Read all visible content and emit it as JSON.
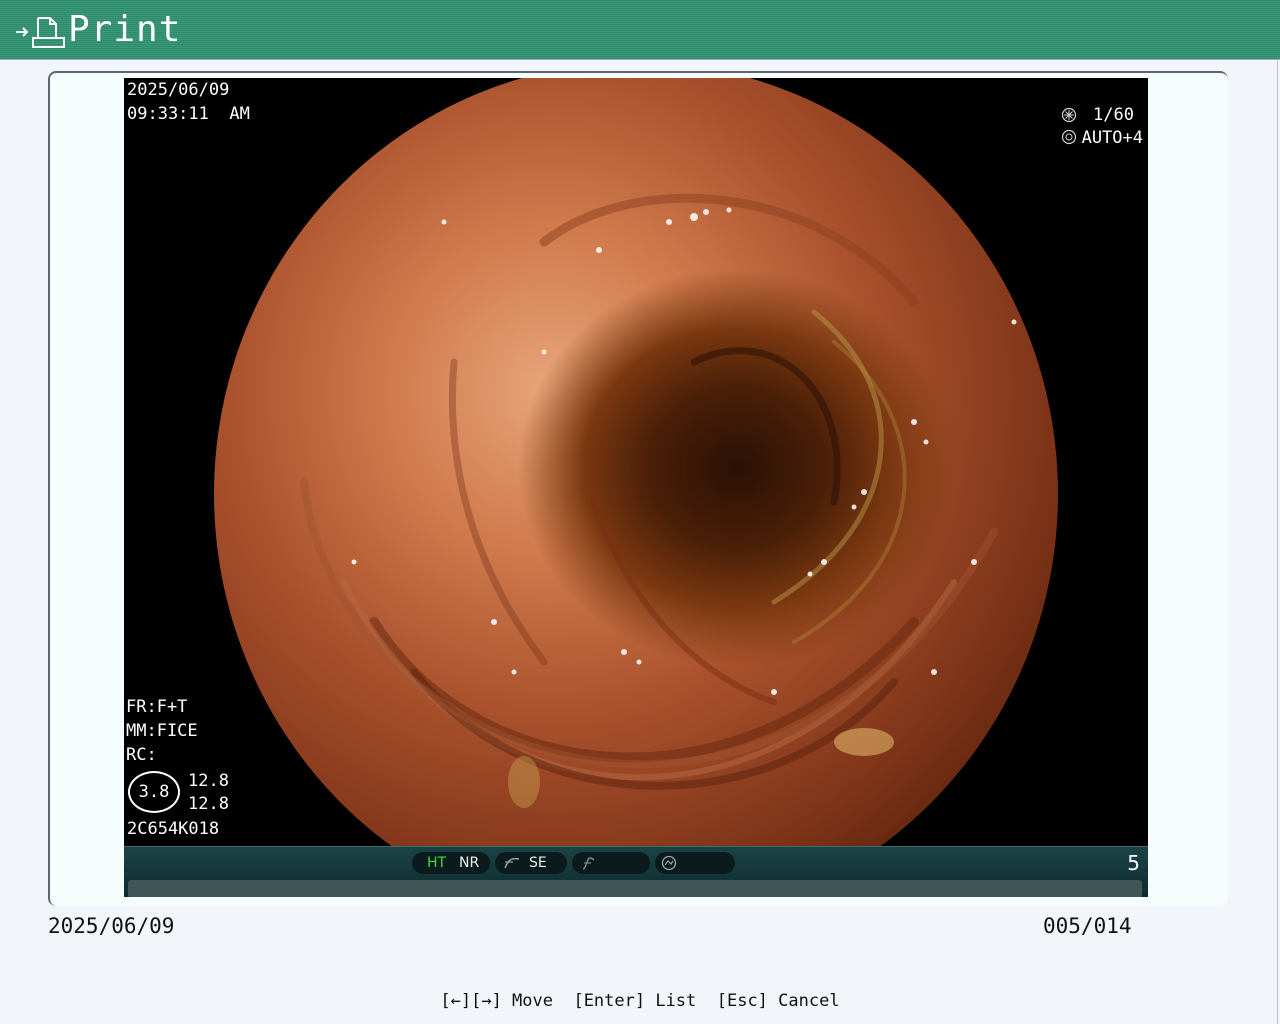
{
  "header": {
    "title": "Print",
    "icon": "print-document-icon"
  },
  "viewer": {
    "date": "2025/06/09",
    "time": "09:33:11  AM",
    "shutter": "1/60",
    "iris": "AUTO+4",
    "fr": "FR:F+T",
    "mm": "MM:FICE",
    "rc": "RC:",
    "ring_value": "3.8",
    "ring_r1": "12.8",
    "ring_r2": "12.8",
    "device_id": "2C654K018",
    "bar": {
      "ht": "HT",
      "nr": "NR",
      "se": "SE",
      "frame_number": "5",
      "ht_color": "#3fdc3f"
    }
  },
  "footer": {
    "date": "2025/06/09",
    "counter": "005/014",
    "help": "[←][→] Move  [Enter] List  [Esc] Cancel"
  },
  "colors": {
    "titlebar": "#2e8a6a",
    "panel": "#f5fdfc",
    "background": "#f2f6fa"
  }
}
